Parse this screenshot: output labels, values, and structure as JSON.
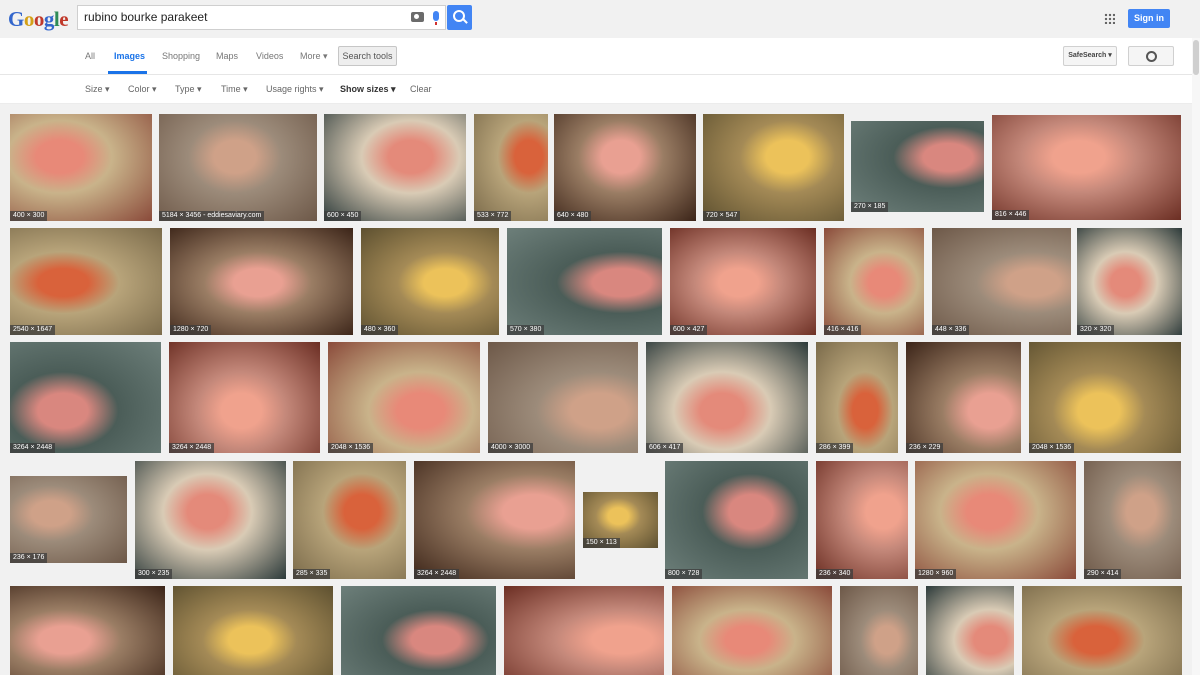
{
  "header": {
    "logo_letters": [
      "G",
      "o",
      "o",
      "g",
      "l",
      "e"
    ],
    "search": {
      "value": "rubino bourke parakeet"
    },
    "signin_label": "Sign in"
  },
  "tabs": [
    {
      "label": "All",
      "active": false
    },
    {
      "label": "Images",
      "active": true
    },
    {
      "label": "Shopping",
      "active": false
    },
    {
      "label": "Maps",
      "active": false
    },
    {
      "label": "Videos",
      "active": false
    },
    {
      "label": "More ▾",
      "active": false
    }
  ],
  "search_tools_label": "Search tools",
  "safesearch_label": "SafeSearch ▾",
  "filters": [
    {
      "label": "Size ▾",
      "bold": false
    },
    {
      "label": "Color ▾",
      "bold": false
    },
    {
      "label": "Type ▾",
      "bold": false
    },
    {
      "label": "Time ▾",
      "bold": false
    },
    {
      "label": "Usage rights ▾",
      "bold": false
    },
    {
      "label": "Show sizes ▾",
      "bold": true
    },
    {
      "label": "Clear",
      "bold": false
    }
  ],
  "colors": {
    "accent": "#4285f4",
    "tab_active": "#1a73e8"
  },
  "results": [
    [
      "400 × 300",
      "5184 × 3456 - eddiesaviary.com",
      "600 × 450",
      "533 × 772",
      "640 × 480",
      "720 × 547",
      "270 × 185",
      "816 × 446"
    ],
    [
      "2540 × 1647",
      "1280 × 720",
      "480 × 360",
      "570 × 380",
      "600 × 427",
      "416 × 416",
      "448 × 336",
      "320 × 320"
    ],
    [
      "3264 × 2448",
      "3264 × 2448",
      "2048 × 1536",
      "4000 × 3000",
      "606 × 417",
      "286 × 399",
      "236 × 229",
      "2048 × 1536"
    ],
    [
      "236 × 176",
      "300 × 235",
      "285 × 335",
      "3264 × 2448",
      "150 × 113",
      "800 × 728",
      "236 × 340",
      "1280 × 960",
      "290 × 414"
    ],
    [
      "",
      "",
      "",
      "",
      "",
      "",
      "",
      ""
    ]
  ]
}
